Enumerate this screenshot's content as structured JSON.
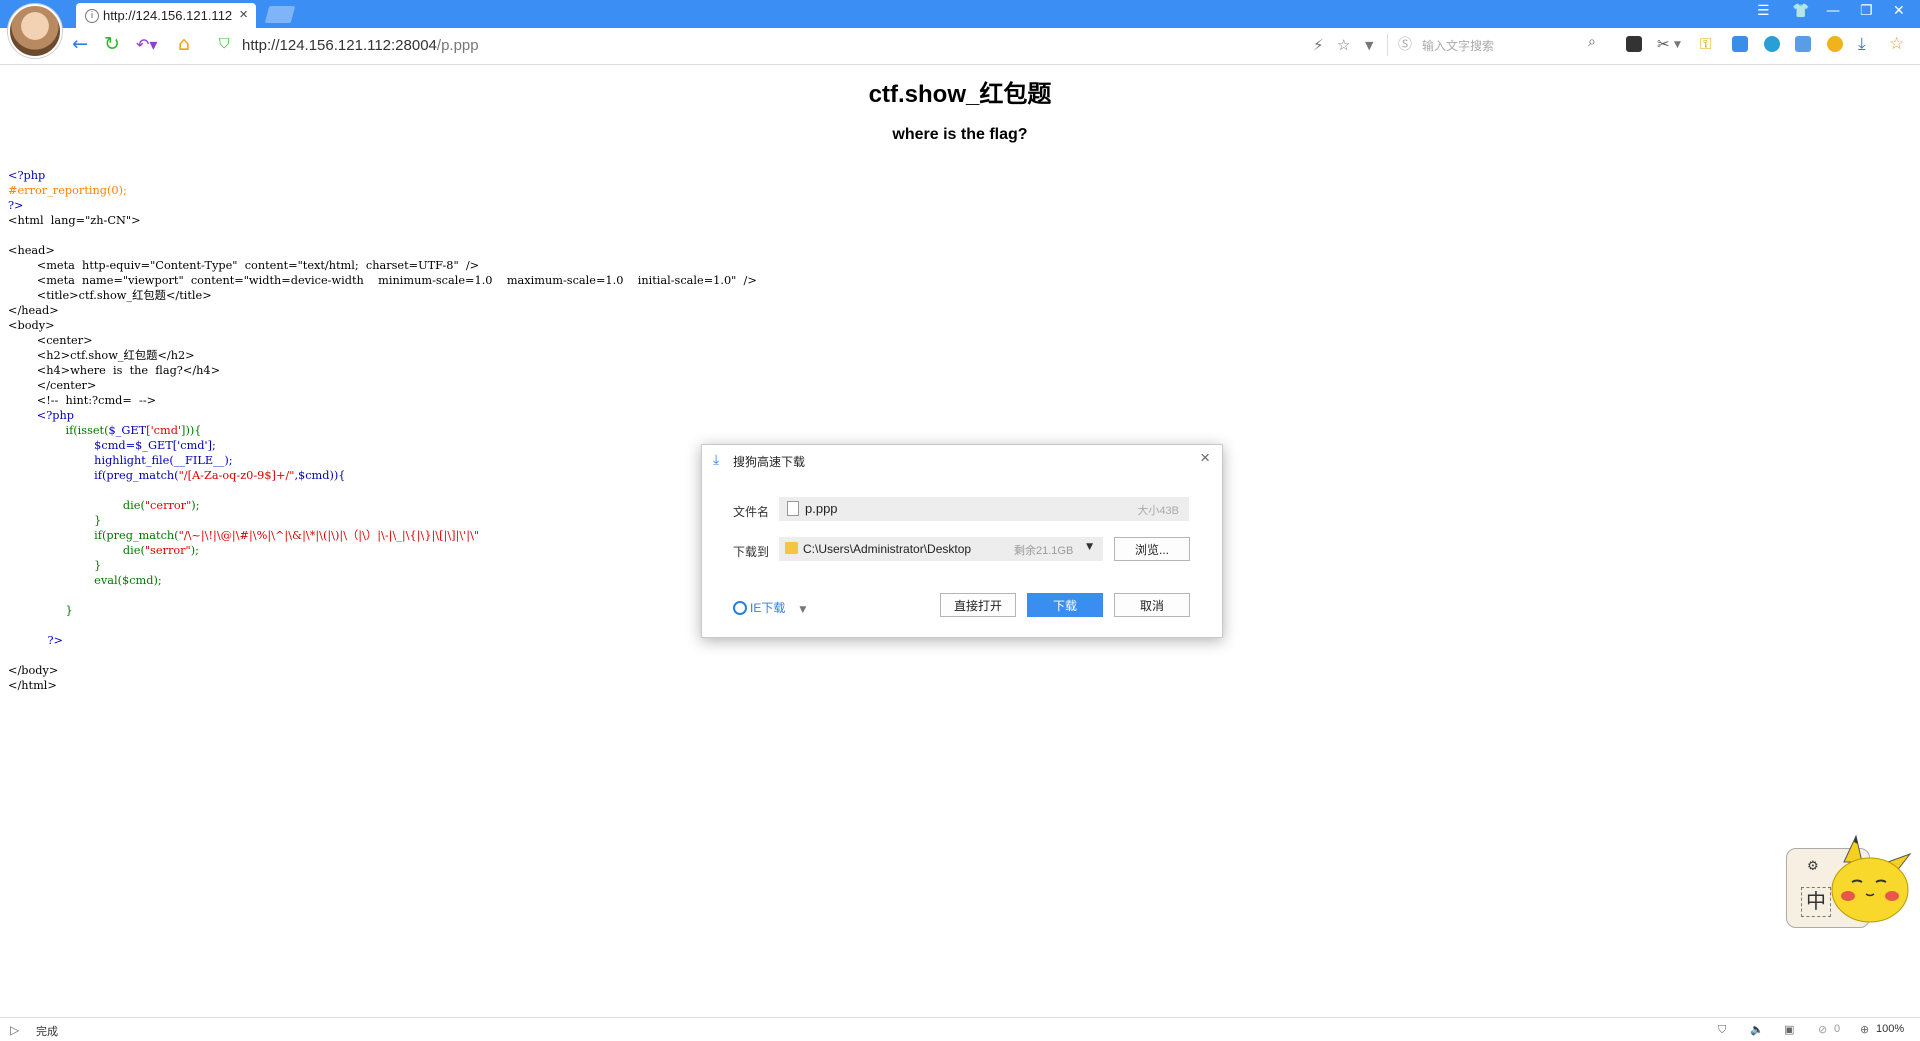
{
  "browser": {
    "tab_title": "http://124.156.121.112",
    "tab_favicon": "i",
    "url_host": "http://124.156.121.112:28004",
    "url_path": "/p.ppp",
    "search_placeholder": "输入文字搜索",
    "accent": "#3b8ff4"
  },
  "page": {
    "heading": "ctf.show_红包题",
    "subheading": "where is the flag?",
    "code": {
      "l1": "<?php",
      "l2": "#error_reporting(0);",
      "l3": "?>",
      "l4": "<html  lang=\"zh-CN\">",
      "l5": "<head>",
      "l6": "        <meta  http-equiv=\"Content-Type\"  content=\"text/html;  charset=UTF-8\"  />",
      "l7": "        <meta  name=\"viewport\"  content=\"width=device-width    minimum-scale=1.0    maximum-scale=1.0    initial-scale=1.0\"  />",
      "l8": "        <title>ctf.show_红包题</title>",
      "l9": "</head>",
      "l10": "<body>",
      "l11": "        <center>",
      "l12": "        <h2>ctf.show_红包题</h2>",
      "l13": "        <h4>where  is  the  flag?</h4>",
      "l14": "        </center>",
      "l15": "        <!--  hint:?cmd=  -->",
      "l16": "        <?php",
      "l17a": "                if(isset(",
      "l17b": "$_GET",
      "l17c": "['cmd'",
      "l17d": "])){",
      "l18": "                        $cmd=$_GET['cmd'];",
      "l19": "                        highlight_file(__FILE__);",
      "l20a": "                        if(preg_match(",
      "l20b": "\"/[A-Za-oq-z0-9$]+/\"",
      "l20c": ",$cmd)){",
      "l21a": "                                die(",
      "l21b": "\"cerror\"",
      "l21c": ");",
      "l22": "                        }",
      "l23a": "                        if(preg_match(",
      "l23b": "\"/\\~|\\!|\\@|\\#|\\%|\\^|\\&|\\*|\\(|\\)|\\（|\\）|\\-|\\_|\\{|\\}|\\[|\\]|\\'|\\\"",
      "l24a": "                                die(",
      "l24b": "\"serror\"",
      "l24c": ");",
      "l25": "                        }",
      "l26": "                        eval($cmd);",
      "l27": "                }",
      "l28": "           ?>",
      "l29": "</body>",
      "l30": "</html>"
    }
  },
  "dialog": {
    "title": "搜狗高速下载",
    "filename_label": "文件名",
    "filename": "p.ppp",
    "filesize": "大小43B",
    "saveto_label": "下载到",
    "path": "C:\\Users\\Administrator\\Desktop",
    "free_space": "剩余21.1GB",
    "browse_label": "浏览...",
    "ie_download_label": "IE下载",
    "open_label": "直接打开",
    "download_label": "下载",
    "cancel_label": "取消"
  },
  "statusbar": {
    "status_text": "完成",
    "count": "0",
    "zoom": "100%"
  },
  "widget": {
    "ime_label": "中"
  }
}
